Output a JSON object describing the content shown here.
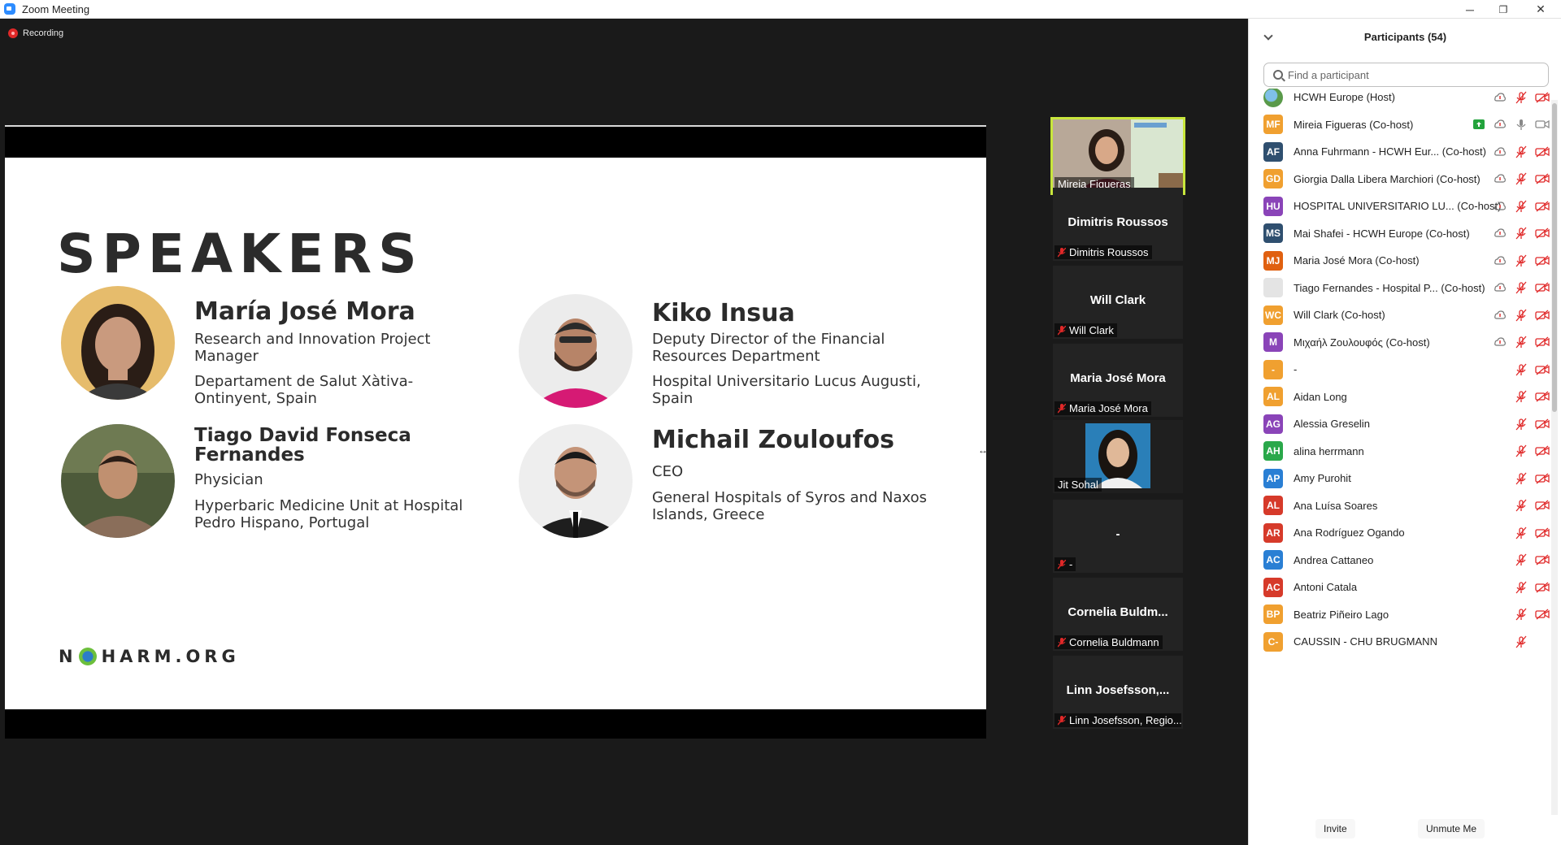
{
  "window": {
    "title": "Zoom Meeting",
    "minimize": "─",
    "restore": "❐",
    "close": "✕"
  },
  "recording": {
    "label": "Recording"
  },
  "slide": {
    "title": "SPEAKERS",
    "speakers": [
      {
        "name": "María José Mora",
        "role": "Research and Innovation Project Manager",
        "org": "Departament de Salut Xàtiva-Ontinyent, Spain"
      },
      {
        "name": "Kiko Insua",
        "role": "Deputy Director of the Financial Resources Department",
        "org": "Hospital Universitario Lucus Augusti, Spain"
      },
      {
        "name": "Tiago David Fonseca Fernandes",
        "role": "Physician",
        "org": "Hyperbaric Medicine Unit at Hospital Pedro Hispano, Portugal"
      },
      {
        "name": "Michail Zouloufos",
        "role": "CEO",
        "org": "General Hospitals of Syros and Naxos Islands, Greece"
      }
    ],
    "logo_left": "N",
    "logo_right": "HARM.ORG"
  },
  "video_strip": [
    {
      "name": "",
      "label": "Mireia Figueras",
      "type": "video-active"
    },
    {
      "name": "Dimitris Roussos",
      "label": "Dimitris Roussos",
      "type": "name"
    },
    {
      "name": "Will Clark",
      "label": "Will Clark",
      "type": "name"
    },
    {
      "name": "Maria José Mora",
      "label": "Maria José Mora",
      "type": "name"
    },
    {
      "name": "",
      "label": "Jit Sohal",
      "type": "video"
    },
    {
      "name": "-",
      "label": "-",
      "type": "name"
    },
    {
      "name": "Cornelia  Buldm...",
      "label": "Cornelia Buldmann",
      "type": "name"
    },
    {
      "name": "Linn Josefsson,...",
      "label": "Linn Josefsson, Regio...",
      "type": "name"
    }
  ],
  "participants": {
    "title": "Participants (54)",
    "search_placeholder": "Find a participant",
    "items": [
      {
        "initials": "",
        "color": "#9aa7b4",
        "name": "HCWH Europe (Host)",
        "raise": true,
        "mic": "muted",
        "video": "off",
        "share": false,
        "globe": true
      },
      {
        "initials": "MF",
        "color": "#f0a030",
        "name": "Mireia Figueras  (Co-host)",
        "raise": true,
        "mic": "on",
        "video": "on",
        "share": true
      },
      {
        "initials": "AF",
        "color": "#2f4f6f",
        "name": "Anna Fuhrmann - HCWH Eur...  (Co-host)",
        "raise": true,
        "mic": "muted",
        "video": "off",
        "share": false
      },
      {
        "initials": "GD",
        "color": "#f0a030",
        "name": "Giorgia Dalla Libera Marchiori (Co-host)",
        "raise": true,
        "mic": "muted",
        "video": "off",
        "share": false
      },
      {
        "initials": "HU",
        "color": "#8a44b8",
        "name": "HOSPITAL UNIVERSITARIO LU... (Co-host)",
        "raise": true,
        "mic": "muted",
        "video": "off",
        "share": false
      },
      {
        "initials": "MS",
        "color": "#2f4f6f",
        "name": "Mai Shafei - HCWH Europe (Co-host)",
        "raise": true,
        "mic": "muted",
        "video": "off",
        "share": false
      },
      {
        "initials": "MJ",
        "color": "#e06010",
        "name": "Maria José Mora (Co-host)",
        "raise": true,
        "mic": "muted",
        "video": "off",
        "share": false
      },
      {
        "initials": "",
        "color": "#d8d8d8",
        "name": "Tiago Fernandes - Hospital P... (Co-host)",
        "raise": true,
        "mic": "muted",
        "video": "off",
        "share": false
      },
      {
        "initials": "WC",
        "color": "#f0a030",
        "name": "Will Clark (Co-host)",
        "raise": true,
        "mic": "muted",
        "video": "off",
        "share": false
      },
      {
        "initials": "M",
        "color": "#8a44b8",
        "name": "Μιχαήλ Ζουλουφός (Co-host)",
        "raise": true,
        "mic": "muted",
        "video": "off",
        "share": false
      },
      {
        "initials": "-",
        "color": "#f0a030",
        "name": "-",
        "raise": false,
        "mic": "muted",
        "video": "off",
        "share": false
      },
      {
        "initials": "AL",
        "color": "#f0a030",
        "name": "Aidan Long",
        "raise": false,
        "mic": "muted",
        "video": "off",
        "share": false
      },
      {
        "initials": "AG",
        "color": "#8a44b8",
        "name": "Alessia Greselin",
        "raise": false,
        "mic": "muted",
        "video": "off",
        "share": false
      },
      {
        "initials": "AH",
        "color": "#2aa84a",
        "name": "alina herrmann",
        "raise": false,
        "mic": "muted",
        "video": "off",
        "share": false
      },
      {
        "initials": "AP",
        "color": "#2a7fd4",
        "name": "Amy Purohit",
        "raise": false,
        "mic": "muted",
        "video": "off",
        "share": false
      },
      {
        "initials": "AL",
        "color": "#d63a2a",
        "name": "Ana Luísa Soares",
        "raise": false,
        "mic": "muted",
        "video": "off",
        "share": false
      },
      {
        "initials": "AR",
        "color": "#d63a2a",
        "name": "Ana Rodríguez Ogando",
        "raise": false,
        "mic": "muted",
        "video": "off",
        "share": false
      },
      {
        "initials": "AC",
        "color": "#2a7fd4",
        "name": "Andrea Cattaneo",
        "raise": false,
        "mic": "muted",
        "video": "off",
        "share": false
      },
      {
        "initials": "AC",
        "color": "#d63a2a",
        "name": "Antoni Catala",
        "raise": false,
        "mic": "muted",
        "video": "off",
        "share": false
      },
      {
        "initials": "BP",
        "color": "#f0a030",
        "name": "Beatriz Piñeiro Lago",
        "raise": false,
        "mic": "muted",
        "video": "off",
        "share": false
      },
      {
        "initials": "C-",
        "color": "#f0a030",
        "name": "CAUSSIN - CHU BRUGMANN",
        "raise": false,
        "mic": "muted",
        "video": "none",
        "share": false
      }
    ]
  },
  "footer": {
    "invite": "Invite",
    "unmute": "Unmute Me"
  },
  "colors": {
    "panel_bg": "#ffffff",
    "stage_bg": "#1a1a1a",
    "active_speaker": "#c8e63c",
    "muted_red": "#e02828",
    "share_green": "#23a33c"
  }
}
